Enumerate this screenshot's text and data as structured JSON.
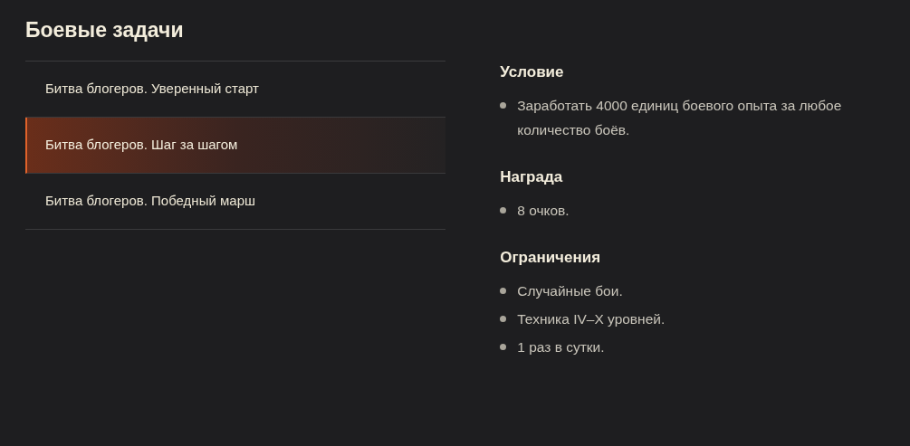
{
  "title": "Боевые задачи",
  "missions": [
    {
      "label": "Битва блогеров. Уверенный старт",
      "selected": false
    },
    {
      "label": "Битва блогеров. Шаг за шагом",
      "selected": true
    },
    {
      "label": "Битва блогеров. Победный марш",
      "selected": false
    }
  ],
  "sections": [
    {
      "heading": "Условие",
      "items": [
        "Заработать 4000 единиц боевого опыта за любое количество боёв."
      ]
    },
    {
      "heading": "Награда",
      "items": [
        "8 очков."
      ]
    },
    {
      "heading": "Ограничения",
      "items": [
        "Случайные бои.",
        "Техника IV–X уровней.",
        "1 раз в сутки."
      ]
    }
  ]
}
